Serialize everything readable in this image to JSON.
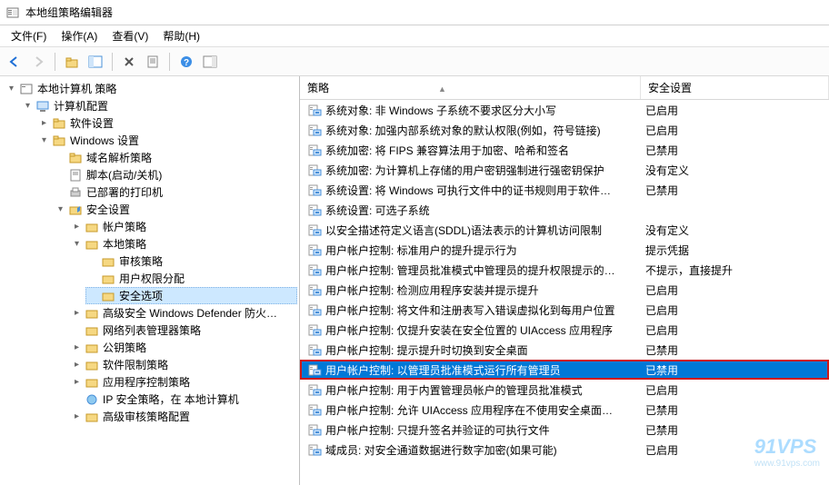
{
  "window": {
    "title": "本地组策略编辑器"
  },
  "menu": {
    "file": "文件(F)",
    "action": "操作(A)",
    "view": "查看(V)",
    "help": "帮助(H)"
  },
  "tree": {
    "root": "本地计算机 策略",
    "computer": "计算机配置",
    "software": "软件设置",
    "windows": "Windows 设置",
    "dns": "域名解析策略",
    "scripts": "脚本(启动/关机)",
    "printers": "已部署的打印机",
    "security": "安全设置",
    "account": "帐户策略",
    "local": "本地策略",
    "audit": "审核策略",
    "userrights": "用户权限分配",
    "secopts": "安全选项",
    "defender": "高级安全 Windows Defender 防火…",
    "netlist": "网络列表管理器策略",
    "pubkey": "公钥策略",
    "swrestrict": "软件限制策略",
    "appctrl": "应用程序控制策略",
    "ipsec": "IP 安全策略，在 本地计算机",
    "advaudit": "高级审核策略配置"
  },
  "list": {
    "col1": "策略",
    "col2": "安全设置",
    "rows": [
      {
        "name": "系统对象: 非 Windows 子系统不要求区分大小写",
        "val": "已启用"
      },
      {
        "name": "系统对象: 加强内部系统对象的默认权限(例如，符号链接)",
        "val": "已启用"
      },
      {
        "name": "系统加密: 将 FIPS 兼容算法用于加密、哈希和签名",
        "val": "已禁用"
      },
      {
        "name": "系统加密: 为计算机上存储的用户密钥强制进行强密钥保护",
        "val": "没有定义"
      },
      {
        "name": "系统设置: 将 Windows 可执行文件中的证书规则用于软件…",
        "val": "已禁用"
      },
      {
        "name": "系统设置: 可选子系统",
        "val": ""
      },
      {
        "name": "以安全描述符定义语言(SDDL)语法表示的计算机访问限制",
        "val": "没有定义"
      },
      {
        "name": "用户帐户控制: 标准用户的提升提示行为",
        "val": "提示凭据"
      },
      {
        "name": "用户帐户控制: 管理员批准模式中管理员的提升权限提示的…",
        "val": "不提示，直接提升"
      },
      {
        "name": "用户帐户控制: 检测应用程序安装并提示提升",
        "val": "已启用"
      },
      {
        "name": "用户帐户控制: 将文件和注册表写入错误虚拟化到每用户位置",
        "val": "已启用"
      },
      {
        "name": "用户帐户控制: 仅提升安装在安全位置的 UIAccess 应用程序",
        "val": "已启用"
      },
      {
        "name": "用户帐户控制: 提示提升时切换到安全桌面",
        "val": "已禁用"
      },
      {
        "name": "用户帐户控制: 以管理员批准模式运行所有管理员",
        "val": "已禁用",
        "hl": true
      },
      {
        "name": "用户帐户控制: 用于内置管理员帐户的管理员批准模式",
        "val": "已启用"
      },
      {
        "name": "用户帐户控制: 允许 UIAccess 应用程序在不使用安全桌面…",
        "val": "已禁用"
      },
      {
        "name": "用户帐户控制: 只提升签名并验证的可执行文件",
        "val": "已禁用"
      },
      {
        "name": "域成员: 对安全通道数据进行数字加密(如果可能)",
        "val": "已启用"
      }
    ]
  },
  "watermark": {
    "main": "91VPS",
    "sub": "www.91vps.com"
  }
}
